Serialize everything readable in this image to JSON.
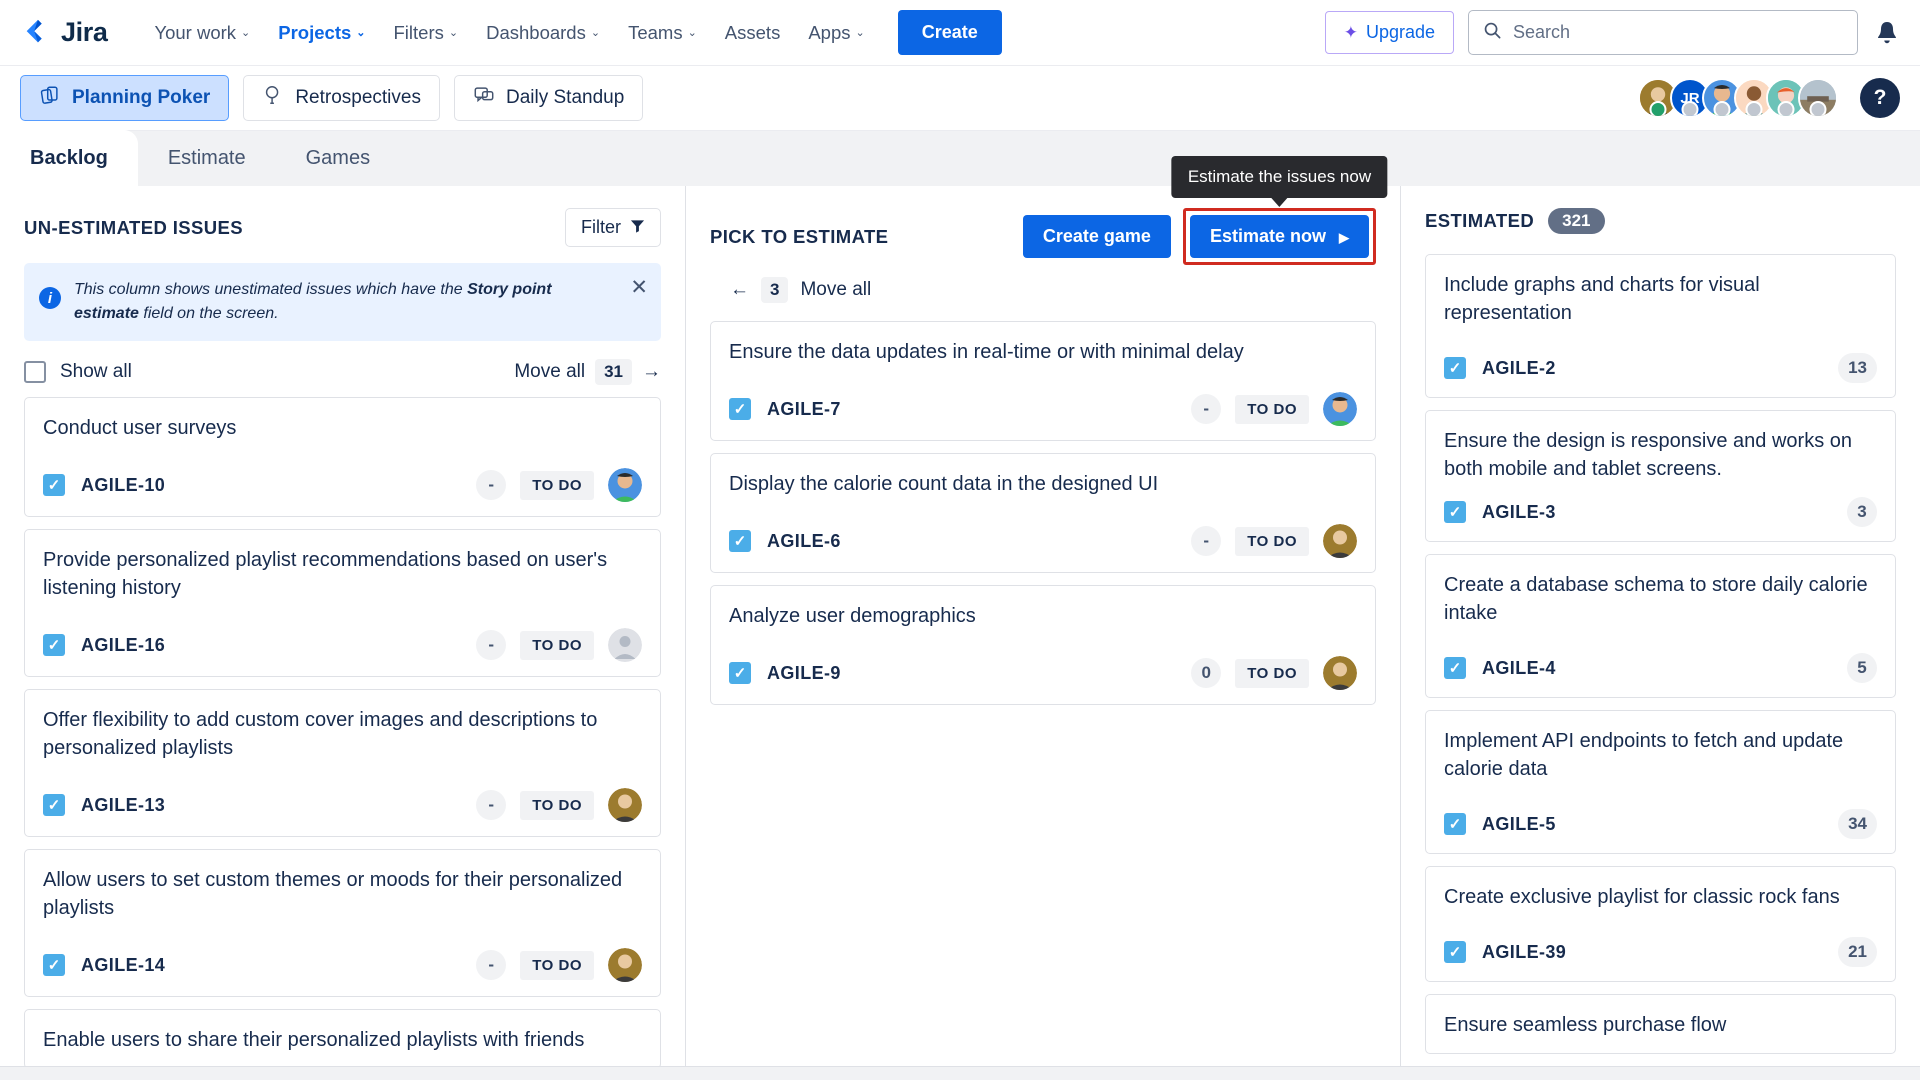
{
  "topnav": {
    "logo_text": "Jira",
    "logo_icon": "jira-logo-icon",
    "items": [
      {
        "label": "Your work",
        "caret": "⌄",
        "active": false
      },
      {
        "label": "Projects",
        "caret": "⌄",
        "active": true
      },
      {
        "label": "Filters",
        "caret": "⌄",
        "active": false
      },
      {
        "label": "Dashboards",
        "caret": "⌄",
        "active": false
      },
      {
        "label": "Teams",
        "caret": "⌄",
        "active": false
      },
      {
        "label": "Assets",
        "caret": "",
        "active": false
      },
      {
        "label": "Apps",
        "caret": "⌄",
        "active": false
      }
    ],
    "create_label": "Create",
    "upgrade_label": "Upgrade",
    "upgrade_icon": "sparkle-icon",
    "search_placeholder": "Search",
    "search_value": "",
    "search_icon": "search-icon",
    "notification_icon": "notification-bell-icon"
  },
  "appbar": {
    "apps": [
      {
        "label": "Planning Poker",
        "icon": "cards-icon",
        "active": true
      },
      {
        "label": "Retrospectives",
        "icon": "magnifier-face-icon",
        "active": false
      },
      {
        "label": "Daily Standup",
        "icon": "speech-bubbles-icon",
        "active": false
      }
    ],
    "avatars": [
      {
        "name": "avatar-user-1",
        "initials": "",
        "bg": "#b5893f",
        "presence": "#22a06b"
      },
      {
        "name": "avatar-user-jr",
        "initials": "JR",
        "bg": "#0055cc",
        "presence": "#c1c7d0"
      },
      {
        "name": "avatar-user-3",
        "initials": "",
        "bg": "#4b92e0",
        "presence": "#c1c7d0"
      },
      {
        "name": "avatar-user-4",
        "initials": "",
        "bg": "#fbd9c1",
        "presence": "#c1c7d0"
      },
      {
        "name": "avatar-user-5",
        "initials": "",
        "bg": "#6cc3b8",
        "presence": "#c1c7d0"
      },
      {
        "name": "avatar-user-6",
        "initials": "",
        "bg": "#9aa9b7",
        "presence": "#c1c7d0"
      }
    ],
    "help_label": "?"
  },
  "tabs": [
    {
      "label": "Backlog",
      "active": true
    },
    {
      "label": "Estimate",
      "active": false
    },
    {
      "label": "Games",
      "active": false
    }
  ],
  "left_column": {
    "title": "UN-ESTIMATED ISSUES",
    "filter_label": "Filter",
    "filter_icon": "funnel-icon",
    "banner": {
      "text_before": "This column shows unestimated issues which have the ",
      "text_bold": "Story point estimate",
      "text_after": " field on the screen.",
      "close_icon": "close-icon",
      "info_icon": "info-icon"
    },
    "show_all_label": "Show all",
    "show_all_checked": false,
    "move_all_label": "Move all",
    "move_all_count": "31",
    "move_all_arrow": "→",
    "cards": [
      {
        "title": "Conduct user surveys",
        "key": "AGILE-10",
        "estimate": "-",
        "status": "TO DO",
        "checked": true,
        "avatar_bg": "#4b92e0"
      },
      {
        "title": "Provide personalized playlist recommendations based on user's listening history",
        "key": "AGILE-16",
        "estimate": "-",
        "status": "TO DO",
        "checked": true,
        "avatar_bg": "#dfe1e6"
      },
      {
        "title": "Offer flexibility to add custom cover images and descriptions to personalized playlists",
        "key": "AGILE-13",
        "estimate": "-",
        "status": "TO DO",
        "checked": true,
        "avatar_bg": "#b5893f"
      },
      {
        "title": "Allow users to set custom themes or moods for their personalized playlists",
        "key": "AGILE-14",
        "estimate": "-",
        "status": "TO DO",
        "checked": true,
        "avatar_bg": "#b5893f"
      },
      {
        "title": "Enable users to share their personalized playlists with friends",
        "key": "",
        "estimate": "",
        "status": "",
        "checked": false,
        "avatar_bg": ""
      }
    ]
  },
  "mid_column": {
    "title": "PICK TO ESTIMATE",
    "create_game_label": "Create game",
    "estimate_now_label": "Estimate now",
    "estimate_now_arrow": "▶",
    "tooltip_text": "Estimate the issues now",
    "move_back_arrow": "←",
    "move_back_count": "3",
    "move_back_label": "Move all",
    "cards": [
      {
        "title": "Ensure the data updates in real-time or with minimal delay",
        "key": "AGILE-7",
        "estimate": "-",
        "status": "TO DO",
        "checked": true,
        "avatar_bg": "#4b92e0"
      },
      {
        "title": "Display the calorie count data in the designed UI",
        "key": "AGILE-6",
        "estimate": "-",
        "status": "TO DO",
        "checked": true,
        "avatar_bg": "#b5893f"
      },
      {
        "title": "Analyze user demographics",
        "key": "AGILE-9",
        "estimate": "0",
        "status": "TO DO",
        "checked": true,
        "avatar_bg": "#b5893f"
      }
    ]
  },
  "right_column": {
    "title": "ESTIMATED",
    "count": "321",
    "cards": [
      {
        "title": "Include graphs and charts for visual representation",
        "key": "AGILE-2",
        "estimate": "13",
        "checked": true
      },
      {
        "title": "Ensure the design is responsive and works on both mobile and tablet screens.",
        "key": "AGILE-3",
        "estimate": "3",
        "checked": true
      },
      {
        "title": "Create a database schema to store daily calorie intake",
        "key": "AGILE-4",
        "estimate": "5",
        "checked": true
      },
      {
        "title": "Implement API endpoints to fetch and update calorie data",
        "key": "AGILE-5",
        "estimate": "34",
        "checked": true
      },
      {
        "title": "Create exclusive playlist for classic rock fans",
        "key": "AGILE-39",
        "estimate": "21",
        "checked": true
      },
      {
        "title": "Ensure seamless purchase flow",
        "key": "",
        "estimate": "",
        "checked": false
      }
    ]
  },
  "colors": {
    "brand_blue": "#0c66e4",
    "accent_light_blue": "#cce0ff",
    "highlight_red": "#d02b20",
    "tooltip_bg": "#292a2e",
    "checkbox_blue": "#4bade8"
  }
}
